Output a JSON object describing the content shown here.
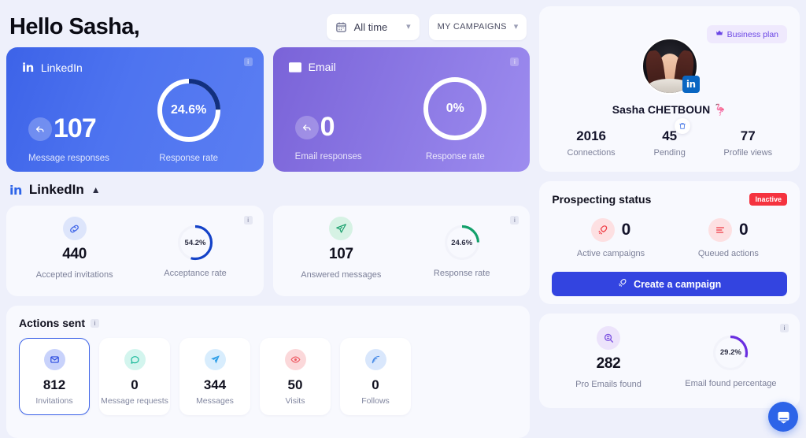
{
  "header": {
    "greeting": "Hello Sasha,",
    "date_filter": {
      "label": "All time",
      "icon": "calendar-icon"
    },
    "campaign_filter": {
      "label": "MY CAMPAIGNS"
    }
  },
  "channels": [
    {
      "name": "LinkedIn",
      "icon": "linkedin-icon",
      "value": "107",
      "value_caption": "Message responses",
      "rate": "24.6%",
      "rate_caption": "Response rate",
      "rate_pct": 24.6,
      "arc_color": "#12307f",
      "track_color": "#ffffff"
    },
    {
      "name": "Email",
      "icon": "envelope-icon",
      "value": "0",
      "value_caption": "Email responses",
      "rate": "0%",
      "rate_caption": "Response rate",
      "rate_pct": 0,
      "arc_color": "#6a4fd0",
      "track_color": "#ffffff"
    }
  ],
  "section": {
    "platform": "LinkedIn",
    "icon": "linkedin-icon",
    "caret": "collapse-caret-icon"
  },
  "stats": [
    {
      "icon": "link-icon",
      "icon_bg": "#dde5fb",
      "icon_color": "#3d63e8",
      "value": "440",
      "caption": "Accepted invitations",
      "rate": "54.2%",
      "rate_caption": "Acceptance rate",
      "rate_pct": 54.2,
      "arc_color": "#1442c8"
    },
    {
      "icon": "send-icon",
      "icon_bg": "#d6f2e4",
      "icon_color": "#1aa06d",
      "value": "107",
      "caption": "Answered messages",
      "rate": "24.6%",
      "rate_caption": "Response rate",
      "rate_pct": 24.6,
      "arc_color": "#12a06a"
    }
  ],
  "actions_sent": {
    "title": "Actions sent",
    "tiles": [
      {
        "icon": "invitation-icon",
        "icon_bg": "#c8d2fb",
        "icon_color": "#2d4ee0",
        "value": "812",
        "caption": "Invitations",
        "selected": true
      },
      {
        "icon": "message-request-icon",
        "icon_bg": "#d3f5ee",
        "icon_color": "#17b899",
        "value": "0",
        "caption": "Message requests",
        "selected": false
      },
      {
        "icon": "paper-plane-icon",
        "icon_bg": "#d8edfd",
        "icon_color": "#2f9fe8",
        "value": "344",
        "caption": "Messages",
        "selected": false
      },
      {
        "icon": "visit-icon",
        "icon_bg": "#fbd8da",
        "icon_color": "#ee5a63",
        "value": "50",
        "caption": "Visits",
        "selected": false
      },
      {
        "icon": "follow-icon",
        "icon_bg": "#d9e7fc",
        "icon_color": "#4d8ee8",
        "value": "0",
        "caption": "Follows",
        "selected": false
      }
    ]
  },
  "profile": {
    "plan_badge": "Business plan",
    "plan_icon": "crown-icon",
    "name": "Sasha CHETBOUN 🦩",
    "avatar": "user-avatar",
    "network_badge": "linkedin-icon",
    "stats": [
      {
        "value": "2016",
        "caption": "Connections"
      },
      {
        "value": "45",
        "caption": "Pending",
        "action_icon": "trash-icon"
      },
      {
        "value": "77",
        "caption": "Profile views"
      }
    ]
  },
  "prospecting": {
    "title": "Prospecting status",
    "status": "Inactive",
    "status_color": "#f5333f",
    "metrics": [
      {
        "icon": "rocket-icon",
        "value": "0",
        "caption": "Active campaigns"
      },
      {
        "icon": "queue-icon",
        "value": "0",
        "caption": "Queued actions"
      }
    ],
    "cta": {
      "label": "Create a campaign",
      "icon": "rocket-icon"
    }
  },
  "email_finder": {
    "icon": "email-search-icon",
    "icon_bg": "#ece3fb",
    "icon_color": "#7a4fe0",
    "value": "282",
    "caption": "Pro Emails found",
    "rate": "29.2%",
    "rate_caption": "Email found percentage",
    "rate_pct": 29.2,
    "arc_color": "#6a2fe0"
  },
  "support": {
    "icon": "intercom-chat-icon"
  }
}
